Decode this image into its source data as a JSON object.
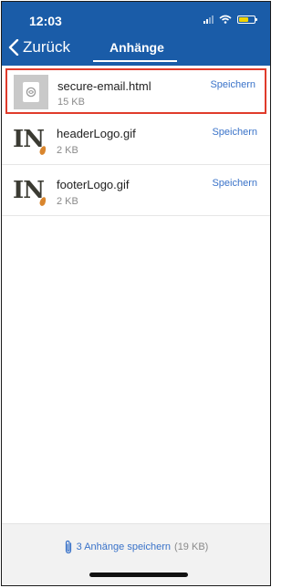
{
  "status": {
    "time": "12:03"
  },
  "nav": {
    "back_label": "Zurück",
    "title": "Anhänge"
  },
  "attachments": [
    {
      "name": "secure-email.html",
      "size": "15 KB",
      "action": "Speichern",
      "icon": "html-file-icon"
    },
    {
      "name": "headerLogo.gif",
      "size": "2 KB",
      "action": "Speichern",
      "icon": "in-logo-thumbnail"
    },
    {
      "name": "footerLogo.gif",
      "size": "2 KB",
      "action": "Speichern",
      "icon": "in-logo-thumbnail"
    }
  ],
  "logo_text": "IN",
  "footer": {
    "save_all_label": "3 Anhänge speichern",
    "total_size": "(19 KB)"
  },
  "colors": {
    "nav_bar": "#1a5ca8",
    "link": "#3a73c9",
    "highlight_border": "#e03b2b",
    "battery": "#f2d300"
  }
}
